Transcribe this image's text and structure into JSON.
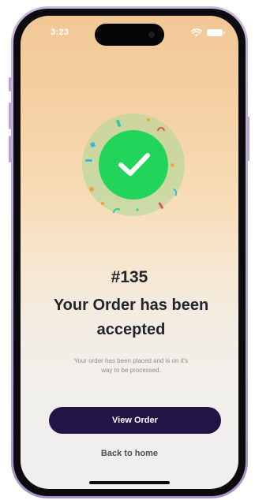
{
  "status_bar": {
    "time": "3:23",
    "wifi_icon": "wifi-icon",
    "battery_icon": "battery-icon"
  },
  "success": {
    "icon": "checkmark-icon",
    "colors": {
      "check_circle": "#22d45a",
      "halo": "#aad796"
    }
  },
  "order": {
    "number": "#135",
    "title": "Your Order has been accepted",
    "subtitle": "Your order has been placed and is on it's way to be processed."
  },
  "actions": {
    "view_order_label": "View Order",
    "back_home_label": "Back to home"
  },
  "colors": {
    "primary_button": "#231446",
    "background_top": "#f2c796",
    "background_bottom": "#f0efee",
    "text_dark": "#22252f",
    "text_muted": "#8d8c93"
  }
}
